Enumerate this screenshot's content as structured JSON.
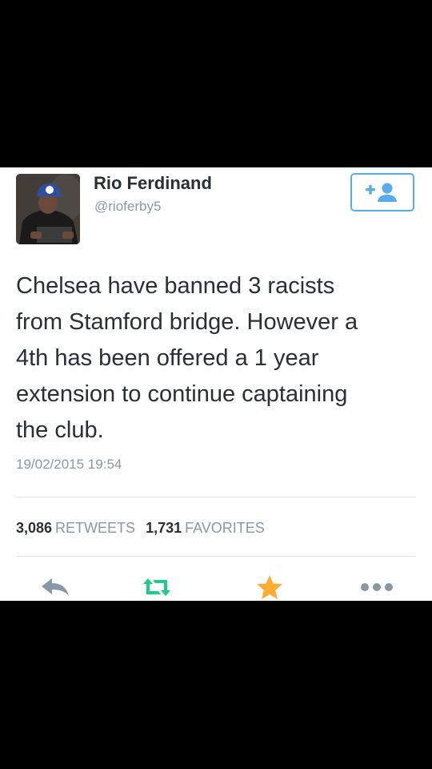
{
  "tweet": {
    "author": {
      "display_name": "Rio Ferdinand",
      "handle": "@rioferby5"
    },
    "text": "Chelsea have banned 3 racists\nfrom Stamford bridge. However a\n4th has been offered a 1 year\nextension to continue captaining\nthe club.",
    "timestamp": "19/02/2015 19:54",
    "stats": {
      "retweets_count": "3,086",
      "retweets_label": "RETWEETS",
      "favorites_count": "1,731",
      "favorites_label": "FAVORITES"
    },
    "follow_button_icon": "add-user-icon",
    "actions": {
      "reply_icon": "reply-icon",
      "retweet_icon": "retweet-icon",
      "favorite_icon": "star-icon",
      "more_icon": "more-icon"
    }
  },
  "colors": {
    "background": "#000000",
    "card": "#ffffff",
    "text": "#292f33",
    "muted": "#8899a6",
    "accent_blue": "#55acee",
    "retweet_green": "#19cf86",
    "favorite_gold": "#ffac33",
    "icon_gray": "#8899a6",
    "divider": "#e1e8ed"
  }
}
